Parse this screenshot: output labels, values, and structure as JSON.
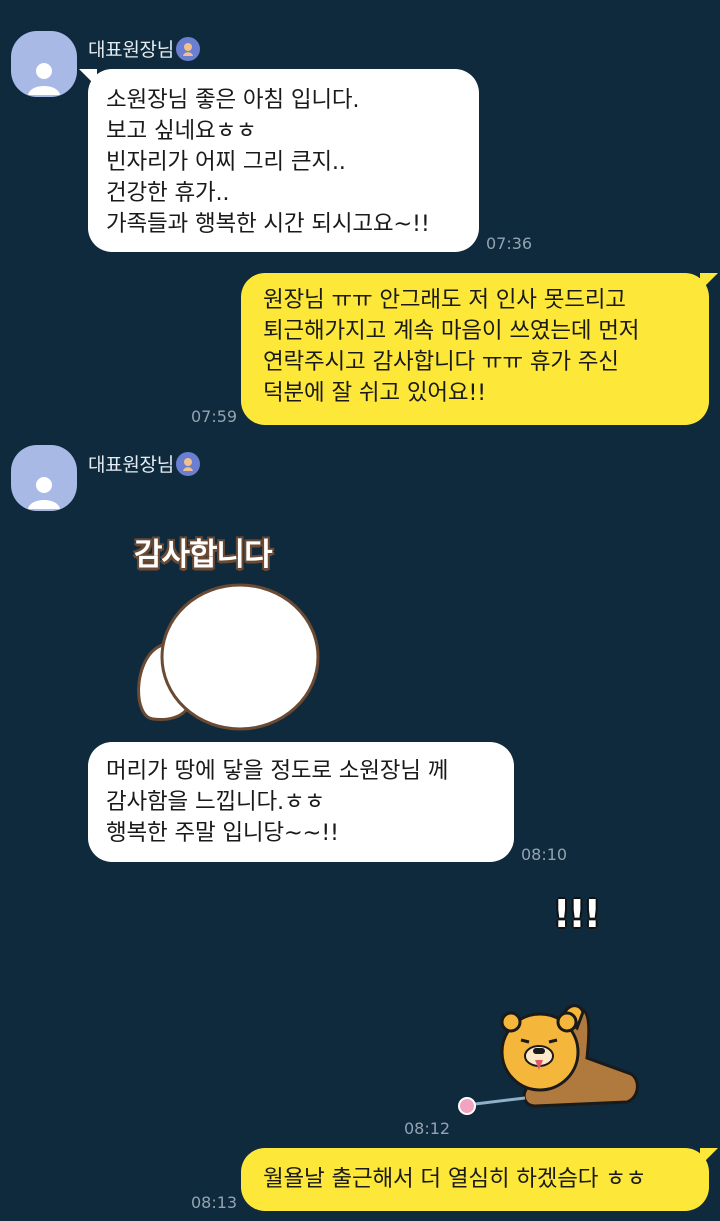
{
  "chat": {
    "messages": [
      {
        "sender": "대표원장님",
        "text_lines": [
          "소원장님 좋은 아침 입니다.",
          "보고 싶네요ㅎㅎ",
          "빈자리가 어찌 그리 큰지..",
          "건강한 휴가..",
          "가족들과 행복한 시간 되시고요~!!"
        ],
        "time": "07:36"
      },
      {
        "text_lines": [
          "원장님 ㅠㅠ 안그래도 저 인사 못드리고",
          "퇴근해가지고 계속 마음이 쓰였는데 먼저",
          "연락주시고 감사합니다 ㅠㅠ 휴가 주신",
          "덕분에 잘 쉬고 있어요!!"
        ],
        "time": "07:59"
      },
      {
        "sender": "대표원장님",
        "sticker_text": "감사합니다",
        "text_lines": [
          "머리가 땅에 닿을 정도로 소원장님 께",
          "감사함을 느낍니다.ㅎㅎ",
          "행복한 주말 입니당~~!!"
        ],
        "time": "08:10"
      },
      {
        "sticker_text": "!!!",
        "time": "08:12"
      },
      {
        "text_lines": [
          "월욜날 출근해서 더 열심히 하겠슴다 ㅎㅎ"
        ],
        "time": "08:13"
      }
    ]
  },
  "colors": {
    "background": "#0f2a3d",
    "incoming_bubble": "#ffffff",
    "outgoing_bubble": "#fde839",
    "timestamp": "#93a3b0"
  }
}
